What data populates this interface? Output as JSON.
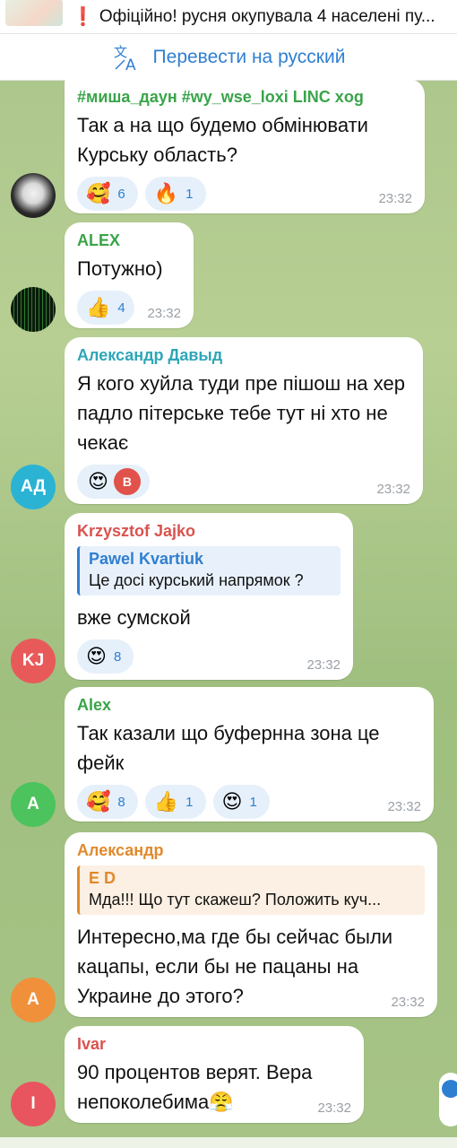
{
  "pinned": {
    "text": "Офіційно! русня окупувала 4 населені пу...",
    "marker": "❗"
  },
  "translate": {
    "label": "Перевести на русский"
  },
  "messages": [
    {
      "sender": "#миша_даун #wy_wse_loxi LINC xog",
      "sender_color": "#3aa44a",
      "text": "Так а на що будемо обмінювати Курську область?",
      "time": "23:32",
      "reactions": [
        {
          "emoji": "🥰",
          "count": "6"
        },
        {
          "emoji": "🔥",
          "count": "1"
        }
      ]
    },
    {
      "sender": "ALEX",
      "sender_color": "#3aa44a",
      "text": "Потужно)",
      "time": "23:32",
      "reactions": [
        {
          "emoji": "👍",
          "count": "4"
        }
      ]
    },
    {
      "sender": "Александр Давыд",
      "sender_color": "#2ea6b8",
      "avatar": "АД",
      "text": "Я кого хуйла туди пре пішош на хер падло пітерське тебе тут ні хто не чекає",
      "time": "23:32",
      "reactions": [
        {
          "emoji": "😍",
          "badge": "В"
        }
      ]
    },
    {
      "sender": "Krzysztof Jajko",
      "sender_color": "#d9534f",
      "avatar": "KJ",
      "reply_name": "Pawel Kvartiuk",
      "reply_text": "Це досі курський напрямок ?",
      "text": "вже сумской",
      "time": "23:32",
      "reactions": [
        {
          "emoji": "😍",
          "count": "8"
        }
      ]
    },
    {
      "sender": "Alex",
      "sender_color": "#3aa44a",
      "avatar": "A",
      "text": "Так казали що буфернна зона це фейк",
      "time": "23:32",
      "reactions": [
        {
          "emoji": "🥰",
          "count": "8"
        },
        {
          "emoji": "👍",
          "count": "1"
        },
        {
          "emoji": "😍",
          "count": "1"
        }
      ]
    },
    {
      "sender": "Александр",
      "sender_color": "#e08a2c",
      "avatar": "A",
      "reply_name": "E D",
      "reply_text": "Мда!!! Що тут скажеш? Положить куч...",
      "text": "Интересно,ма где бы сейчас были кацапы, если бы не пацаны на Украине до этого?",
      "time": "23:32"
    },
    {
      "sender": "Ivar",
      "sender_color": "#d9534f",
      "avatar": "I",
      "text": "90 процентов верят. Вера непоколебима😤",
      "time": "23:32"
    }
  ],
  "colors": {
    "accent": "#2f7fd1",
    "avatar_ad": "#2bb3d3",
    "avatar_kj": "#e85a5a",
    "avatar_alex": "#4cc35c",
    "avatar_aleksandr": "#f0903a",
    "avatar_ivar": "#e8555f"
  }
}
